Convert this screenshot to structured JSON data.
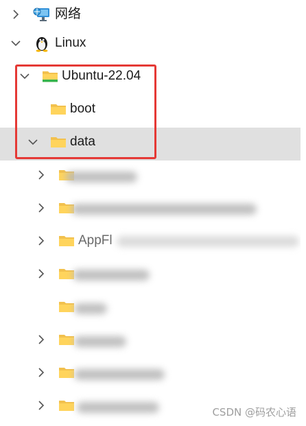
{
  "tree": {
    "network": {
      "label": "网络",
      "icon": "network-monitor-icon"
    },
    "linux": {
      "label": "Linux",
      "icon": "tux-penguin-icon"
    },
    "ubuntu": {
      "label": "Ubuntu-22.04",
      "icon": "linux-distro-folder-icon"
    },
    "boot": {
      "label": "boot",
      "icon": "folder-icon"
    },
    "data": {
      "label": "data",
      "icon": "folder-icon"
    },
    "subfolders": [
      {
        "label": "",
        "has_children": true,
        "redacted": true
      },
      {
        "label": "",
        "has_children": true,
        "redacted": true
      },
      {
        "label": "AppFl",
        "has_children": true,
        "redacted": true
      },
      {
        "label": "",
        "has_children": true,
        "redacted": true
      },
      {
        "label": "",
        "has_children": false,
        "redacted": true
      },
      {
        "label": "",
        "has_children": true,
        "redacted": true
      },
      {
        "label": "",
        "has_children": true,
        "redacted": true
      },
      {
        "label": "",
        "has_children": true,
        "redacted": true
      }
    ]
  },
  "colors": {
    "highlight_border": "#e53935",
    "selected_row": "#e0e0e0",
    "folder_fill": "#ffd45c"
  },
  "watermark": "CSDN @码农心语"
}
